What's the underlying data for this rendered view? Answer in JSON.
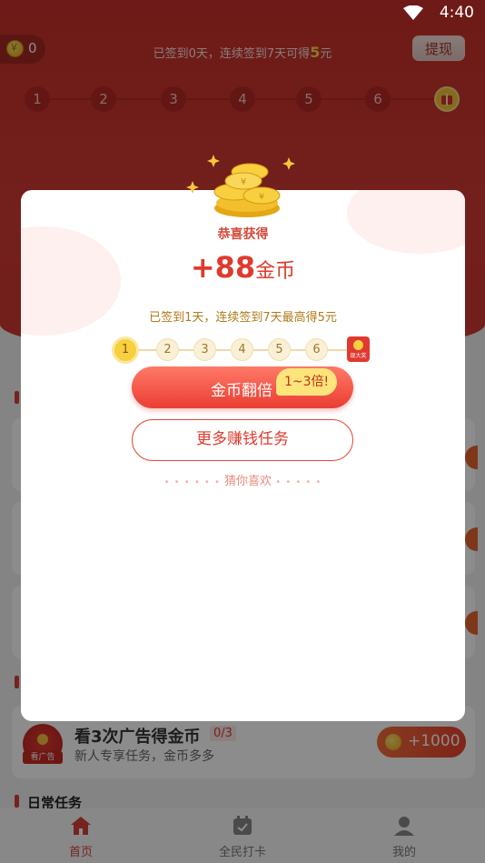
{
  "status_bar": {
    "time": "4:40"
  },
  "header": {
    "coin_balance": "0",
    "signin_text_prefix": "已签到0天，连续签到7天可得",
    "signin_text_amount": "5",
    "signin_text_suffix": "元",
    "withdraw_label": "提现",
    "progress_days": [
      "1",
      "2",
      "3",
      "4",
      "5",
      "6"
    ]
  },
  "modal": {
    "congrats": "恭喜获得",
    "reward_amount": "+88",
    "reward_unit": "金币",
    "subtitle": "已签到1天，连续签到7天最高得5元",
    "progress_days": [
      "1",
      "2",
      "3",
      "4",
      "5",
      "6"
    ],
    "gift_label": "现大奖",
    "double_button": "金币翻倍",
    "double_badge": "1~3倍!",
    "more_button": "更多赚钱任务",
    "guess_label": "猜你喜欢",
    "guess_dots_left": "• • • • • •",
    "guess_dots_right": "• • • • •"
  },
  "task": {
    "icon_tag": "看广告",
    "title": "看3次广告得金币",
    "count": "0/3",
    "desc": "新人专享任务，金币多多",
    "reward": "+1000"
  },
  "section": {
    "daily_title": "日常任务"
  },
  "nav": {
    "items": [
      {
        "label": "首页",
        "active": true
      },
      {
        "label": "全民打卡",
        "active": false
      },
      {
        "label": "我的",
        "active": false
      }
    ]
  },
  "colors": {
    "brand_red": "#d23a33",
    "accent_gold": "#f7cf3f"
  }
}
